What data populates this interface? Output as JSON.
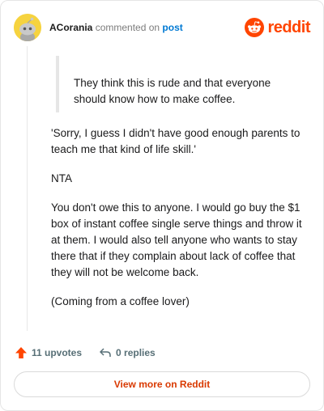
{
  "header": {
    "author": "ACorania",
    "action": "commented on",
    "post_link": "post",
    "brand_name": "reddit",
    "brand_color": "#ff4500"
  },
  "quote": {
    "text": "They think this is rude and that everyone should know how to make coffee."
  },
  "comment": {
    "paragraphs": [
      "'Sorry, I guess I didn't have good enough parents to teach me that kind of life skill.'",
      "NTA",
      "You don't owe this to anyone. I would go buy the $1 box of instant coffee single serve things and throw it at them. I would also tell anyone who wants to stay there that if they complain about lack of coffee that they will not be welcome back.",
      "(Coming from a coffee lover)"
    ]
  },
  "actions": {
    "upvotes": "11 upvotes",
    "replies": "0 replies",
    "upvote_icon": "upvote-arrow-icon",
    "reply_icon": "reply-arrow-icon"
  },
  "footer": {
    "view_more": "View more on Reddit"
  }
}
